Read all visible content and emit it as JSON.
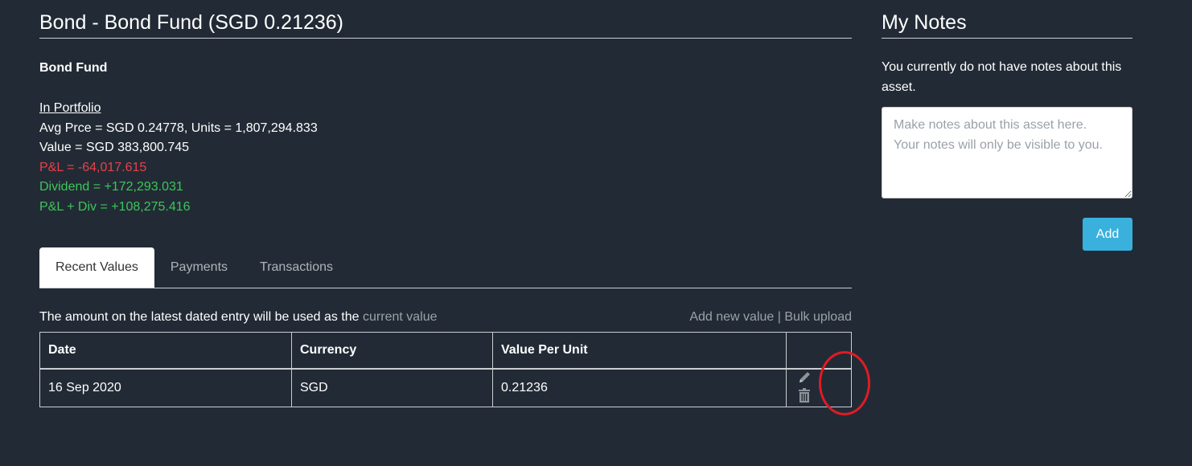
{
  "asset": {
    "title": "Bond - Bond Fund (SGD 0.21236)",
    "name": "Bond Fund",
    "in_portfolio_label": "In Portfolio",
    "avg_line": "Avg Prce = SGD 0.24778, Units = 1,807,294.833",
    "value_line": "Value = SGD 383,800.745",
    "pl_line": "P&L = -64,017.615",
    "dividend_line": "Dividend = +172,293.031",
    "pl_div_line": "P&L + Div = +108,275.416",
    "colors": {
      "negative": "#e8414a",
      "positive": "#3cc65a"
    }
  },
  "tabs": [
    {
      "label": "Recent Values",
      "active": true
    },
    {
      "label": "Payments",
      "active": false
    },
    {
      "label": "Transactions",
      "active": false
    }
  ],
  "values_panel": {
    "hint_text": "The amount on the latest dated entry will be used as the ",
    "hint_link": "current value",
    "add_new_value": "Add new value",
    "separator": "|",
    "bulk_upload": "Bulk upload"
  },
  "table": {
    "headers": [
      "Date",
      "Currency",
      "Value Per Unit",
      ""
    ],
    "rows": [
      {
        "date": "16 Sep 2020",
        "currency": "SGD",
        "value_per_unit": "0.21236",
        "icons": [
          "pencil-icon",
          "trash-icon"
        ]
      }
    ]
  },
  "notes": {
    "title": "My Notes",
    "empty_message": "You currently do not have notes about this asset.",
    "placeholder": "Make notes about this asset here.\nYour notes will only be visible to you.",
    "value": "",
    "add_label": "Add"
  },
  "theme": {
    "background": "#222b35",
    "accent": "#3ab1dc",
    "highlight_circle": "#e01b24"
  }
}
